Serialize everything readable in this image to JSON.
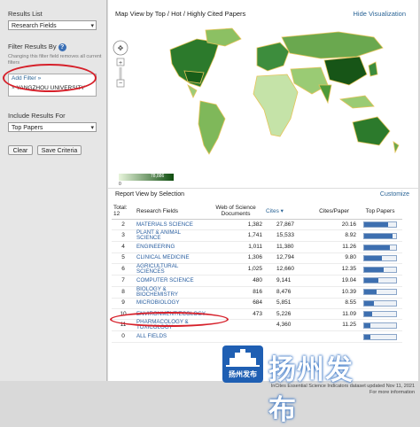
{
  "sidebar": {
    "results_list_label": "Results List",
    "results_list_value": "Research Fields",
    "filter_label": "Filter Results By",
    "filter_note": "Changing this filter field removes all current filters",
    "add_filter_label": "Add Filter »",
    "filter_value": "YANGZHOU UNIVERSITY",
    "include_label": "Include Results For",
    "include_value": "Top Papers",
    "clear_label": "Clear",
    "save_label": "Save Criteria"
  },
  "map": {
    "title": "Map View by Top / Hot / Highly Cited Papers",
    "hide_label": "Hide Visualization",
    "legend_min": "0",
    "legend_max": "78,886"
  },
  "report": {
    "title": "Report View by Selection",
    "customize_label": "Customize",
    "total_label": "Total:",
    "total_value": "12",
    "columns": [
      "Research Fields",
      "Web of Science Documents",
      "Cites",
      "Cites/Paper",
      "Top Papers"
    ],
    "rows": [
      {
        "rank": "2",
        "field": "MATERIALS SCIENCE",
        "docs": "1,382",
        "cites": "27,867",
        "cpp": "20.16",
        "top": 0.75
      },
      {
        "rank": "3",
        "field": "PLANT & ANIMAL SCIENCE",
        "docs": "1,741",
        "cites": "15,533",
        "cpp": "8.92",
        "top": 0.9
      },
      {
        "rank": "4",
        "field": "ENGINEERING",
        "docs": "1,011",
        "cites": "11,380",
        "cpp": "11.26",
        "top": 0.8
      },
      {
        "rank": "5",
        "field": "CLINICAL MEDICINE",
        "docs": "1,306",
        "cites": "12,794",
        "cpp": "9.80",
        "top": 0.55
      },
      {
        "rank": "6",
        "field": "AGRICULTURAL SCIENCES",
        "docs": "1,025",
        "cites": "12,660",
        "cpp": "12.35",
        "top": 0.6
      },
      {
        "rank": "7",
        "field": "COMPUTER SCIENCE",
        "docs": "480",
        "cites": "9,141",
        "cpp": "19.04",
        "top": 0.45
      },
      {
        "rank": "8",
        "field": "BIOLOGY & BIOCHEMISTRY",
        "docs": "816",
        "cites": "8,476",
        "cpp": "10.39",
        "top": 0.4
      },
      {
        "rank": "9",
        "field": "MICROBIOLOGY",
        "docs": "684",
        "cites": "5,851",
        "cpp": "8.55",
        "top": 0.3
      },
      {
        "rank": "10",
        "field": "ENVIRONMENT/ECOLOGY",
        "docs": "473",
        "cites": "5,226",
        "cpp": "11.09",
        "top": 0.25
      },
      {
        "rank": "11",
        "field": "PHARMACOLOGY & TOXICOLOGY",
        "docs": "",
        "cites": "4,360",
        "cpp": "11.25",
        "top": 0.2
      },
      {
        "rank": "0",
        "field": "ALL FIELDS",
        "docs": "",
        "cites": "",
        "cpp": "",
        "top": 0.18
      }
    ]
  },
  "footer": {
    "line1": "InCites Essential Science Indicators dataset updated Nov 11, 2021",
    "line2": "For more information"
  },
  "watermark": {
    "logo_text": "扬州发布",
    "text": "扬州发布"
  },
  "colors": {
    "accent": "#2a6496",
    "bar": "#3d6fb0",
    "map_dark": "#1e6b1e",
    "map_light": "#d6ecc3",
    "annotation": "#d6202a"
  }
}
